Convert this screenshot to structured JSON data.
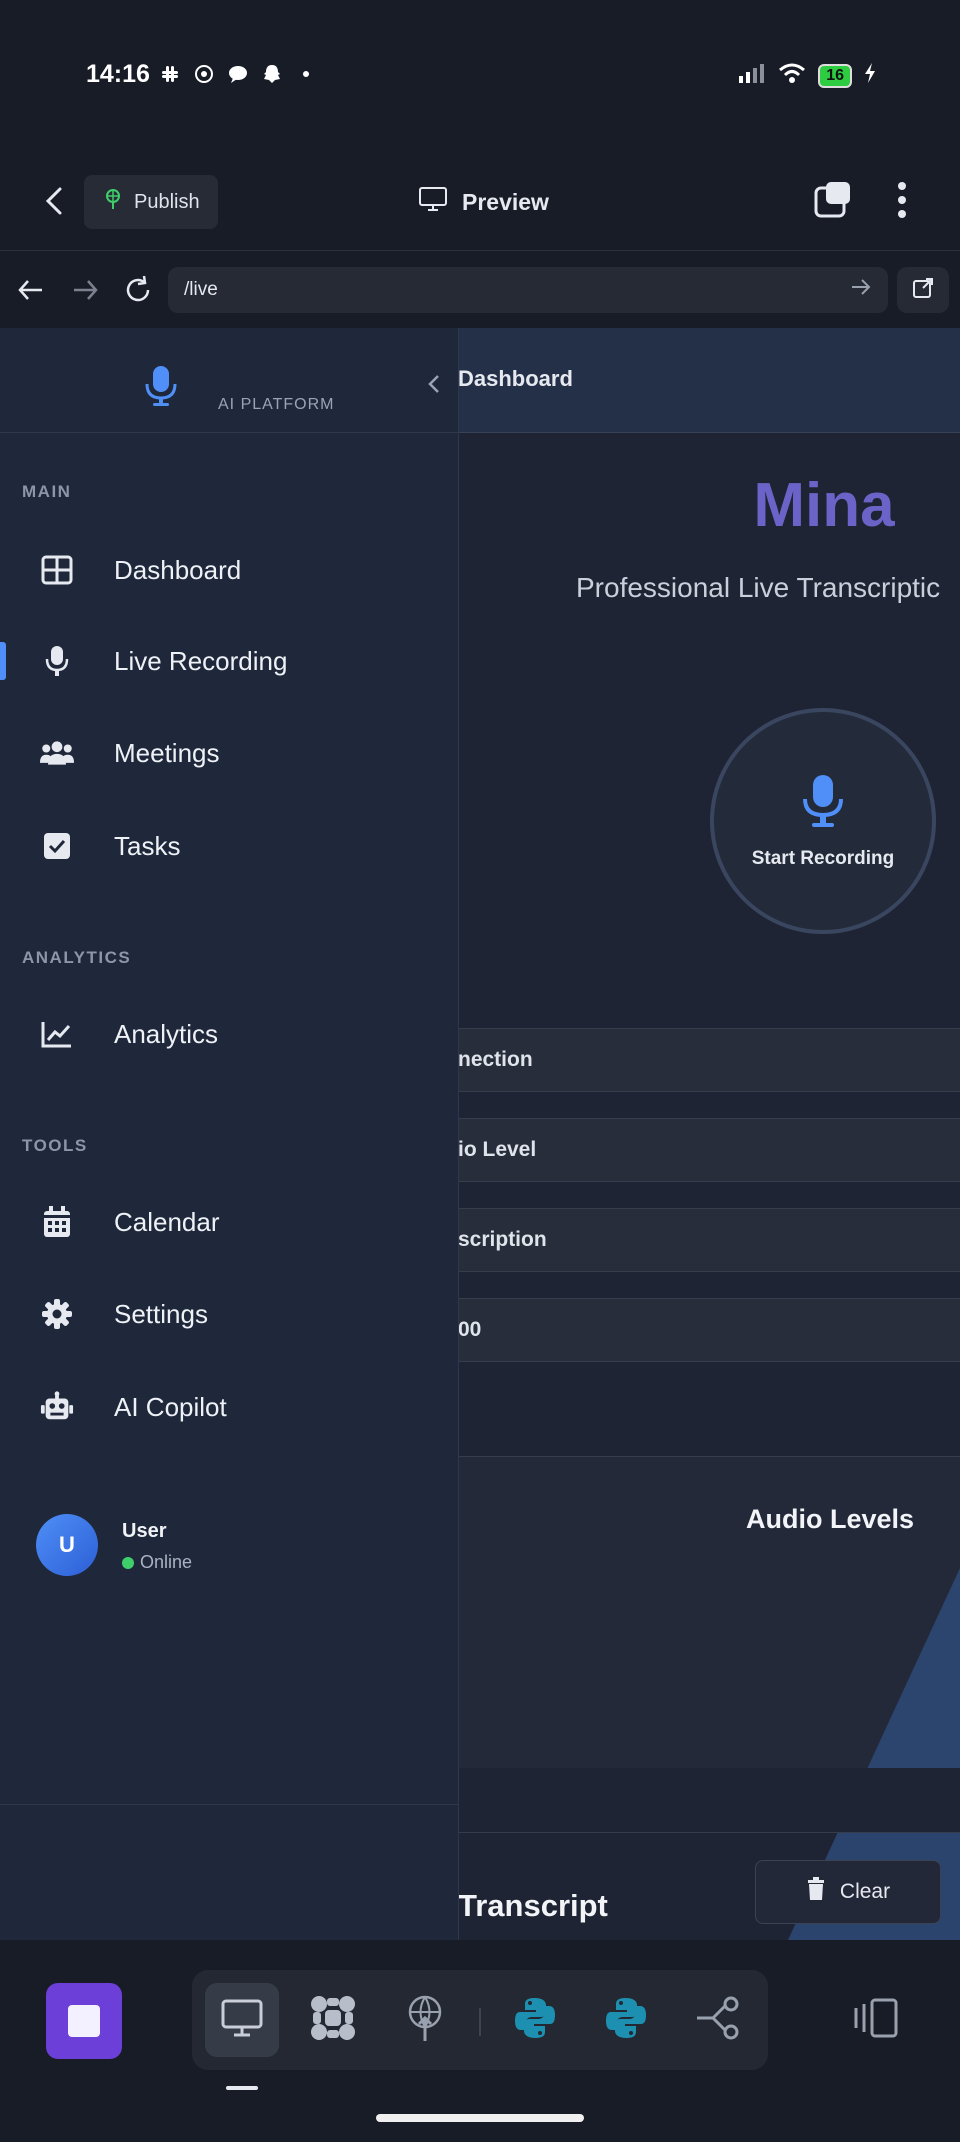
{
  "status_bar": {
    "time": "14:16",
    "battery": "16"
  },
  "app_bar": {
    "publish_label": "Publish",
    "preview_label": "Preview"
  },
  "url_bar": {
    "url": "/live"
  },
  "sidebar": {
    "brand_sub": "AI PLATFORM",
    "sections": {
      "main": "MAIN",
      "analytics": "ANALYTICS",
      "tools": "TOOLS"
    },
    "items": [
      {
        "label": "Dashboard",
        "icon": "grid-icon"
      },
      {
        "label": "Live Recording",
        "icon": "microphone-icon",
        "active": true
      },
      {
        "label": "Meetings",
        "icon": "users-icon"
      },
      {
        "label": "Tasks",
        "icon": "checkbox-icon"
      },
      {
        "label": "Analytics",
        "icon": "chart-line-icon"
      },
      {
        "label": "Calendar",
        "icon": "calendar-icon"
      },
      {
        "label": "Settings",
        "icon": "gear-icon"
      },
      {
        "label": "AI Copilot",
        "icon": "robot-icon"
      }
    ],
    "user": {
      "initial": "U",
      "name": "User",
      "status": "Online"
    }
  },
  "main": {
    "breadcrumb": "Dashboard",
    "brand": "Mina",
    "subtitle": "Professional Live Transcriptic",
    "record_button": "Start Recording",
    "stats": [
      "nection",
      "io Level",
      "scription",
      "00"
    ],
    "audio_title": "Audio Levels",
    "transcript_title": "Transcript",
    "clear_label": "Clear"
  },
  "colors": {
    "accent": "#4f8ff7",
    "brand": "#6c63c8",
    "stop_button": "#6c3fd8",
    "online": "#3ecf6a"
  }
}
